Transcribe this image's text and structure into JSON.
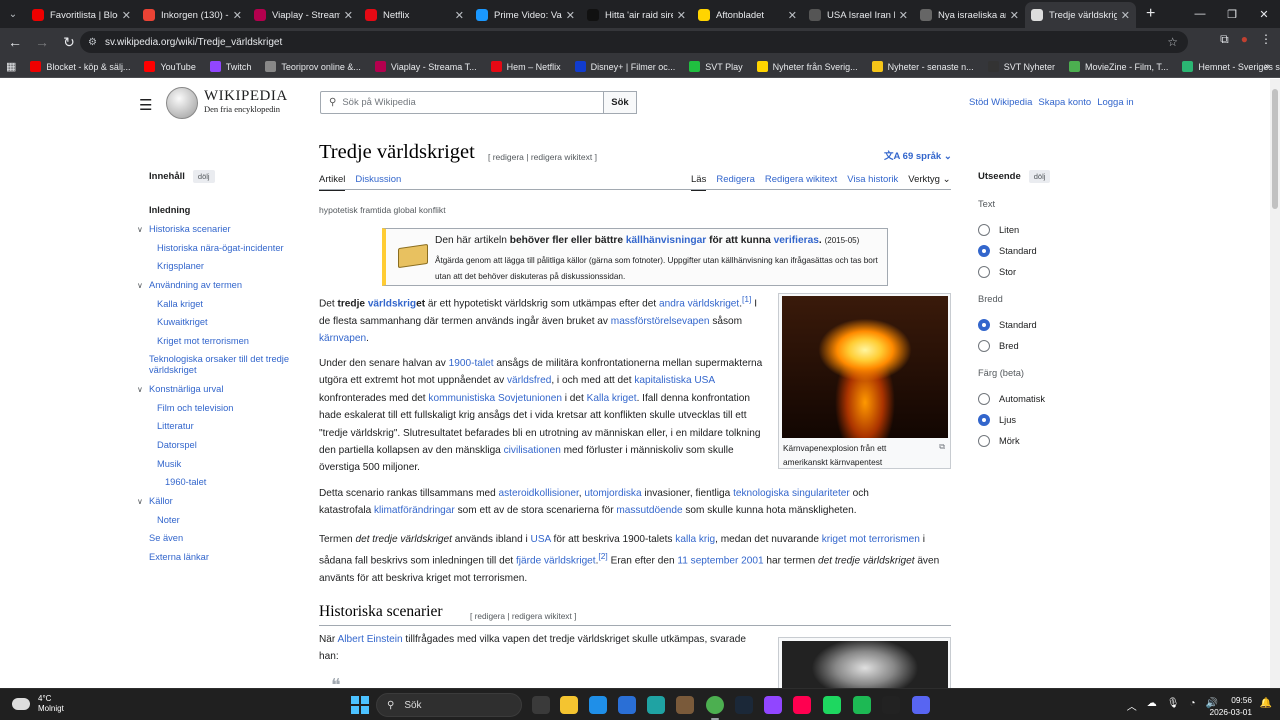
{
  "browser": {
    "tabs": [
      {
        "title": "Favoritlista | Blocket",
        "color": "#e00"
      },
      {
        "title": "Inkorgen (130) - s",
        "color": "#ea4335"
      },
      {
        "title": "Viaplay - Streama",
        "color": "#b4004e"
      },
      {
        "title": "Netflix",
        "color": "#e50914"
      },
      {
        "title": "Prime Video: Vakt",
        "color": "#1a98ff"
      },
      {
        "title": "Hitta 'air raid sire",
        "color": "#111"
      },
      {
        "title": "Aftonbladet",
        "color": "#ffd400"
      },
      {
        "title": "USA Israel Iran Ko",
        "color": "#555"
      },
      {
        "title": "Nya israeliska ant",
        "color": "#666"
      },
      {
        "title": "Tredje världskrige",
        "color": "#ddd"
      }
    ],
    "url": "sv.wikipedia.org/wiki/Tredje_världskriget",
    "bookmarks": [
      {
        "label": "Blocket - köp & sälj...",
        "color": "#e00"
      },
      {
        "label": "YouTube",
        "color": "#f00"
      },
      {
        "label": "Twitch",
        "color": "#9146ff"
      },
      {
        "label": "Teoriprov online &...",
        "color": "#888"
      },
      {
        "label": "Viaplay - Streama T...",
        "color": "#b4004e"
      },
      {
        "label": "Hem – Netflix",
        "color": "#e50914"
      },
      {
        "label": "Disney+ | Filmer oc...",
        "color": "#113ccf"
      },
      {
        "label": "SVT Play",
        "color": "#20c040"
      },
      {
        "label": "Nyheter från Sverig...",
        "color": "#ffd400"
      },
      {
        "label": "Nyheter - senaste n...",
        "color": "#f5c518"
      },
      {
        "label": "SVT Nyheter",
        "color": "#333"
      },
      {
        "label": "MovieZine - Film, T...",
        "color": "#4caf50"
      },
      {
        "label": "Hemnet - Sveriges s...",
        "color": "#2bb673"
      }
    ]
  },
  "wiki": {
    "logo_title": "WIKIPEDIA",
    "logo_tagline": "Den fria encyklopedin",
    "search_placeholder": "Sök på Wikipedia",
    "search_button": "Sök",
    "user_links": [
      "Stöd Wikipedia",
      "Skapa konto",
      "Logga in"
    ],
    "toc": {
      "heading": "Innehåll",
      "hide": "dölj",
      "items": [
        "Inledning",
        "Historiska scenarier",
        "Historiska nära-ögat-incidenter",
        "Krigsplaner",
        "Användning av termen",
        "Kalla kriget",
        "Kuwaitkriget",
        "Kriget mot terrorismen",
        "Teknologiska orsaker till det tredje världskriget",
        "Konstnärliga urval",
        "Film och television",
        "Litteratur",
        "Datorspel",
        "Musik",
        "1960-talet",
        "Källor",
        "Noter",
        "Se även",
        "Externa länkar"
      ]
    },
    "title": "Tredje världskriget",
    "title_edit": "[ redigera | redigera wikitext ]",
    "languages": "69 språk",
    "tabs_left": [
      "Artikel",
      "Diskussion"
    ],
    "tabs_right": [
      "Läs",
      "Redigera",
      "Redigera wikitext",
      "Visa historik",
      "Verktyg"
    ],
    "short_desc": "hypotetisk framtida global konflikt",
    "ambox": {
      "line1_pre": "Den här artikeln ",
      "line1_bold": "behöver fler eller bättre ",
      "line1_link": "källhänvisningar",
      "line1_mid": " för att kunna ",
      "line1_link2": "verifieras",
      "line1_date": "(2015-05)",
      "line2": "Åtgärda genom att lägga till pålitliga källor (gärna som fotnoter). Uppgifter utan källhänvisning kan ifrågasättas och tas bort utan att det behöver diskuteras på diskussionssidan."
    },
    "paragraphs": [
      "Det tredje världskriget är ett hypotetiskt världskrig som utkämpas efter det andra världskriget.[1] I de flesta sammanhang där termen används ingår även bruket av massförstörelsevapen såsom kärnvapen.",
      "Under den senare halvan av 1900-talet ansågs de militära konfrontationerna mellan supermakterna utgöra ett extremt hot mot uppnåendet av världsfred, i och med att det kapitalistiska USA konfronterades med det kommunistiska Sovjetunionen i det Kalla kriget. Ifall denna konfrontation hade eskalerat till ett fullskaligt krig ansågs det i vida kretsar att konflikten skulle utvecklas till ett \"tredje världskrig\". Slutresultatet befarades bli en utrotning av människan eller, i en mildare tolkning den partiella kollapsen av den mänskliga civilisationen med förluster i människoliv som skulle överstiga 500 miljoner.",
      "Detta scenario rankas tillsammans med asteroidkollisioner, utomjordiska invasioner, fientliga teknologiska singulariteter och katastrofala klimatförändringar som ett av de stora scenarierna för massutdöende som skulle kunna hota mänskligheten.",
      "Termen det tredje världskriget används ibland i USA för att beskriva 1900-talets kalla krig, medan det nuvarande kriget mot terrorismen i sådana fall beskrivs som inledningen till det fjärde världskriget.[2] Eran efter den 11 september 2001 har termen det tredje världskriget även använts för att beskriva kriget mot terrorismen."
    ],
    "thumb_caption": "Kärnvapenexplosion från ett amerikanskt kärnvapentest",
    "h2": "Historiska scenarier",
    "h2_edit": "[ redigera | redigera wikitext ]",
    "h2_para": "När Albert Einstein tillfrågades med vilka vapen det tredje världskriget skulle utkämpas, svarade han:",
    "appearance": {
      "heading": "Utseende",
      "hide": "dölj",
      "text_label": "Text",
      "text_options": [
        "Liten",
        "Standard",
        "Stor"
      ],
      "text_selected": "Standard",
      "width_label": "Bredd",
      "width_options": [
        "Standard",
        "Bred"
      ],
      "width_selected": "Standard",
      "color_label": "Färg (beta)",
      "color_options": [
        "Automatisk",
        "Ljus",
        "Mörk"
      ],
      "color_selected": "Ljus"
    }
  },
  "taskbar": {
    "temp": "4°C",
    "weather": "Molnigt",
    "search": "Sök",
    "time": "09:56",
    "date": "2026-03-01"
  }
}
